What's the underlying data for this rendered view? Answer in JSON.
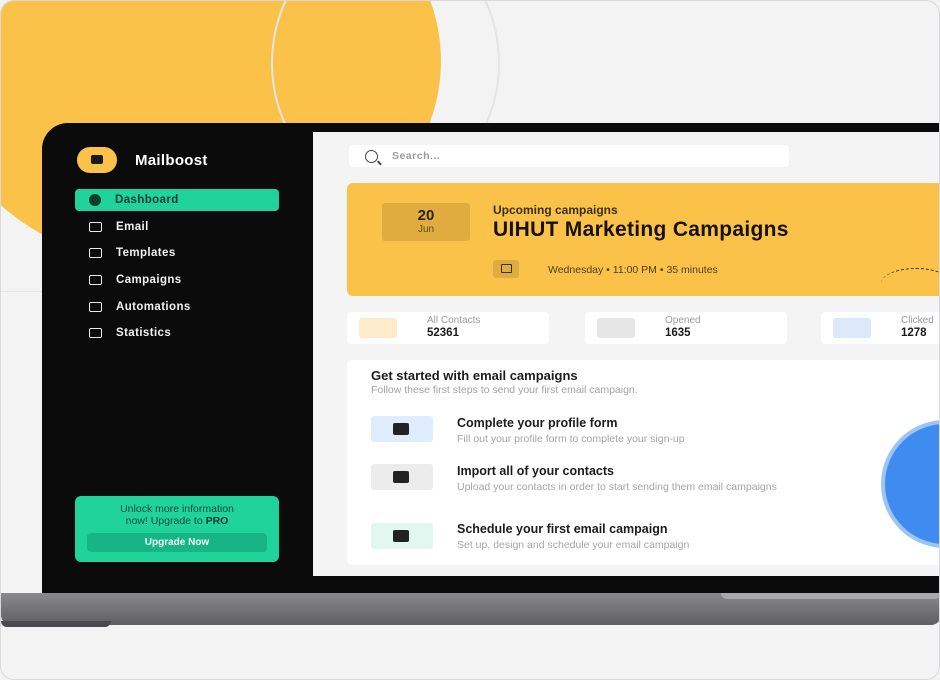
{
  "brand": {
    "name": "Mailboost"
  },
  "nav": {
    "items": [
      {
        "label": "Dashboard",
        "icon": "pie-chart-icon",
        "active": true
      },
      {
        "label": "Email",
        "icon": "mail-icon"
      },
      {
        "label": "Templates",
        "icon": "template-icon"
      },
      {
        "label": "Campaigns",
        "icon": "megaphone-icon"
      },
      {
        "label": "Automations",
        "icon": "automation-icon"
      },
      {
        "label": "Statistics",
        "icon": "bar-chart-icon"
      }
    ]
  },
  "upgrade": {
    "line1": "Unlock more information",
    "line2_prefix": "now! Upgrade to ",
    "line2_bold": "PRO",
    "button_label": "Upgrade Now"
  },
  "search": {
    "placeholder": "Search..."
  },
  "campaign": {
    "date_day": "20",
    "date_month": "Jun",
    "subtitle": "Upcoming campaigns",
    "title": "UIHUT Marketing Campaigns",
    "meta": "Wednesday • 11:00 PM • 35 minutes"
  },
  "stats": [
    {
      "label": "All Contacts",
      "value": "52361",
      "icon": "users-icon",
      "color": "#fdeccb"
    },
    {
      "label": "Opened",
      "value": "1635",
      "icon": "eye-icon",
      "color": "#e6e6e6"
    },
    {
      "label": "Clicked",
      "value": "1278",
      "icon": "pointer-icon",
      "color": "#dce9fb"
    }
  ],
  "getstarted": {
    "title": "Get started with email campaigns",
    "subtitle": "Follow these first steps to send your first email campaign.",
    "steps": [
      {
        "title": "Complete your profile form",
        "desc": "Fill out your profile form to complete your sign-up",
        "icon": "checkbox-icon",
        "color": "#dfecfb"
      },
      {
        "title": "Import all of your contacts",
        "desc": "Upload your contacts in order to start sending them email campaigns",
        "icon": "users-icon",
        "color": "#ececec"
      },
      {
        "title": "Schedule your first email campaign",
        "desc": "Set up, design and schedule your email campaign",
        "icon": "mail-icon",
        "color": "#e1f7ef"
      }
    ]
  },
  "colors": {
    "accent": "#1fd39a",
    "brand": "#fbc24a",
    "sidebar_bg": "#0b0b0c"
  }
}
